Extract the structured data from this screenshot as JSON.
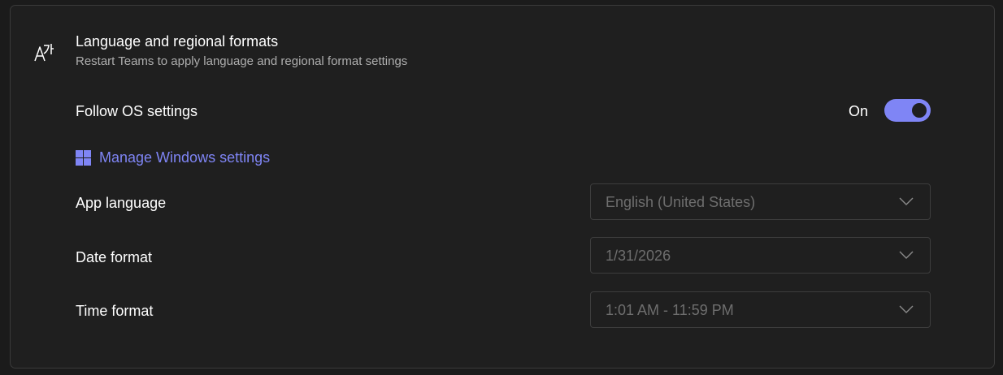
{
  "section": {
    "icon": "language-icon",
    "title": "Language and regional formats",
    "subtitle": "Restart Teams to apply language and regional format settings"
  },
  "follow_os": {
    "label": "Follow OS settings",
    "state_label": "On",
    "enabled": true
  },
  "manage_link": {
    "icon": "windows-icon",
    "label": "Manage Windows settings"
  },
  "settings": [
    {
      "label": "App language",
      "value": "English (United States)",
      "disabled": true
    },
    {
      "label": "Date format",
      "value": "1/31/2026",
      "disabled": true
    },
    {
      "label": "Time format",
      "value": "1:01 AM - 11:59 PM",
      "disabled": true
    }
  ],
  "colors": {
    "accent": "#7f85f5",
    "background": "#1f1f1f",
    "border": "#3a3a3a",
    "text_primary": "#ffffff",
    "text_secondary": "#adadad",
    "text_disabled": "#6e6e6e"
  }
}
